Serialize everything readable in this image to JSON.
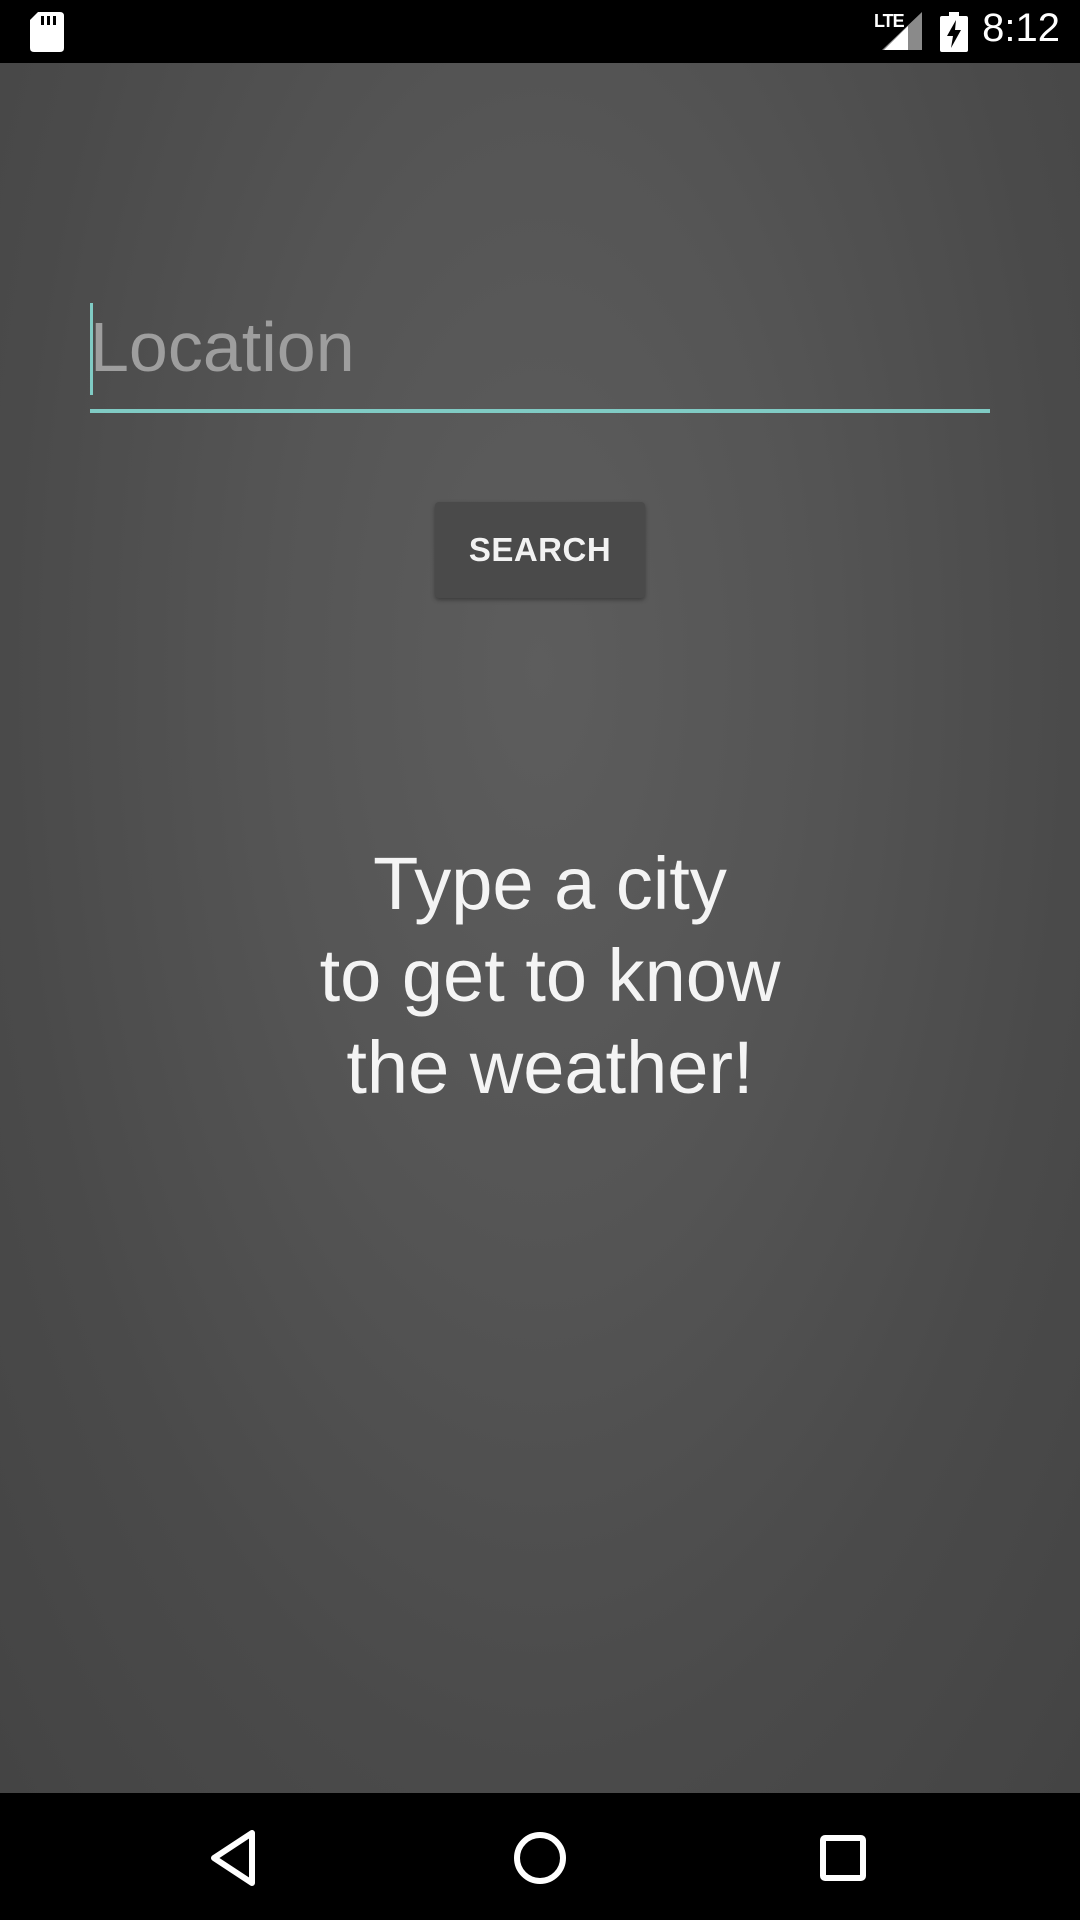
{
  "status_bar": {
    "network_label": "LTE",
    "time": "8:12",
    "icons": [
      "sd-card-icon",
      "signal-icon",
      "battery-charging-icon"
    ]
  },
  "search_form": {
    "location_placeholder": "Location",
    "location_value": "",
    "search_label": "SEARCH",
    "accent_color": "#80cbc4"
  },
  "hint": {
    "lines": [
      "Type a city",
      "to get to know",
      "the weather!"
    ]
  },
  "nav_bar": {
    "icons": [
      "back-icon",
      "home-icon",
      "recents-icon"
    ]
  }
}
